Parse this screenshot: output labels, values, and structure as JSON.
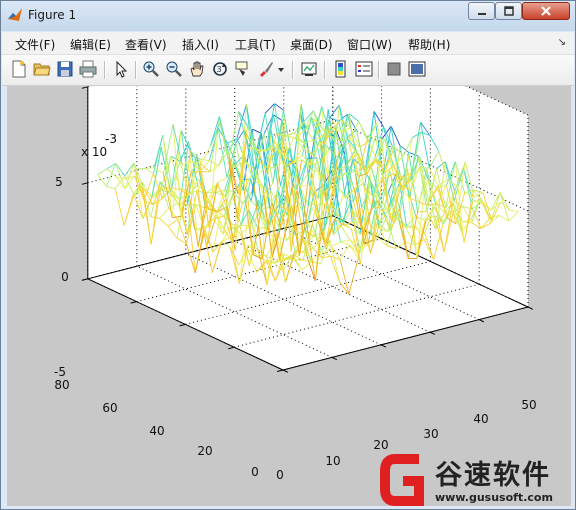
{
  "window": {
    "title": "Figure 1"
  },
  "menu": [
    {
      "label": "文件(F)"
    },
    {
      "label": "编辑(E)"
    },
    {
      "label": "查看(V)"
    },
    {
      "label": "插入(I)"
    },
    {
      "label": "工具(T)"
    },
    {
      "label": "桌面(D)"
    },
    {
      "label": "窗口(W)"
    },
    {
      "label": "帮助(H)"
    }
  ],
  "toolbar": [
    "new-figure-icon",
    "open-file-icon",
    "save-icon",
    "print-icon",
    "pointer-icon",
    "zoom-in-icon",
    "zoom-out-icon",
    "pan-icon",
    "rotate-3d-icon",
    "data-cursor-icon",
    "brush-icon",
    "link-plot-icon",
    "colorbar-icon",
    "legend-icon",
    "hide-plot-tools-icon",
    "show-plot-tools-icon"
  ],
  "axes": {
    "z_exponent_label": "x 10",
    "z_exponent_power": "-3",
    "z_ticks": [
      "5",
      "0",
      "-5"
    ],
    "y_ticks": [
      "80",
      "60",
      "40",
      "20",
      "0"
    ],
    "x_ticks": [
      "0",
      "10",
      "20",
      "30",
      "40",
      "50"
    ]
  },
  "watermark": {
    "brand": "谷速软件",
    "url": "www.gususoft.com"
  },
  "colors": {
    "surface_low": "#f7f742",
    "surface_mid": "#3cd2c8",
    "surface_high": "#1a3cd0"
  }
}
